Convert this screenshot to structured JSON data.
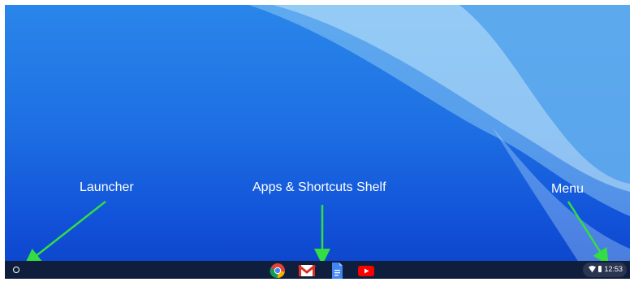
{
  "annotations": {
    "launcher": "Launcher",
    "shelf": "Apps & Shortcuts Shelf",
    "menu": "Menu"
  },
  "shelf": {
    "apps": [
      {
        "name": "chrome",
        "icon": "chrome-icon"
      },
      {
        "name": "gmail",
        "icon": "gmail-icon"
      },
      {
        "name": "docs",
        "icon": "docs-icon"
      },
      {
        "name": "youtube",
        "icon": "youtube-icon"
      }
    ]
  },
  "status_tray": {
    "time": "12:53",
    "icons": [
      "wifi-icon",
      "battery-icon"
    ]
  },
  "colors": {
    "arrow": "#33dd44",
    "shelf_bg": "#0f1e3d",
    "wallpaper_top": "#2a86ea",
    "wallpaper_bottom": "#0c43c9"
  }
}
